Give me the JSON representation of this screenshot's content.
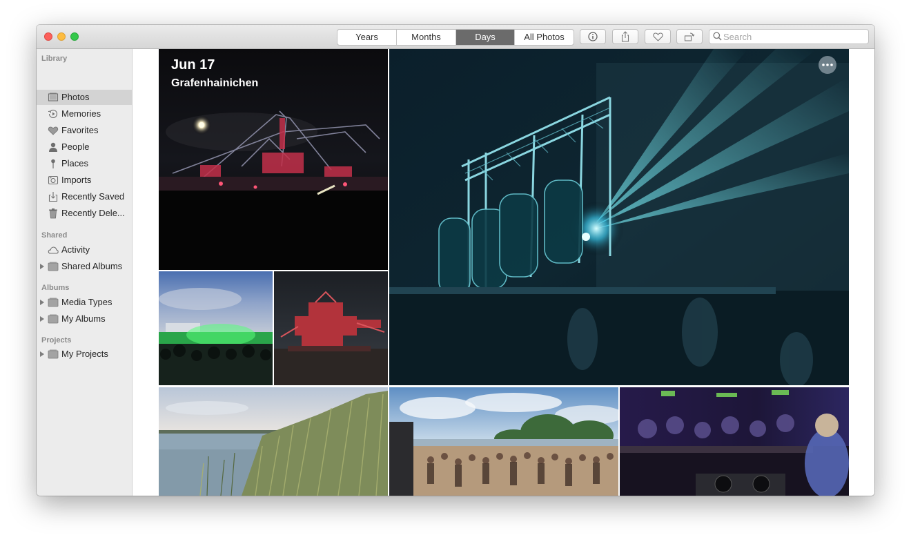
{
  "toolbar": {
    "segments": [
      {
        "label": "Years",
        "active": false
      },
      {
        "label": "Months",
        "active": false
      },
      {
        "label": "Days",
        "active": true
      },
      {
        "label": "All Photos",
        "active": false
      }
    ],
    "buttons": [
      "info-icon",
      "share-icon",
      "heart-icon",
      "rotate-icon"
    ],
    "search_placeholder": "Search"
  },
  "sidebar": {
    "library_title": "Library",
    "library_items": [
      {
        "label": "Photos",
        "icon": "photos-icon",
        "selected": true
      },
      {
        "label": "Memories",
        "icon": "memories-icon"
      },
      {
        "label": "Favorites",
        "icon": "heart-icon"
      },
      {
        "label": "People",
        "icon": "person-icon"
      },
      {
        "label": "Places",
        "icon": "pin-icon"
      },
      {
        "label": "Imports",
        "icon": "camera-icon"
      },
      {
        "label": "Recently Saved",
        "icon": "download-icon"
      },
      {
        "label": "Recently Dele...",
        "icon": "trash-icon"
      }
    ],
    "shared_title": "Shared",
    "shared_items": [
      {
        "label": "Activity",
        "icon": "cloud-icon"
      },
      {
        "label": "Shared Albums",
        "icon": "folder-icon",
        "disclosure": true
      }
    ],
    "albums_title": "Albums",
    "album_items": [
      {
        "label": "Media Types",
        "icon": "folder-icon",
        "disclosure": true
      },
      {
        "label": "My Albums",
        "icon": "folder-icon",
        "disclosure": true
      }
    ],
    "projects_title": "Projects",
    "project_items": [
      {
        "label": "My Projects",
        "icon": "folder-icon",
        "disclosure": true
      }
    ]
  },
  "day": {
    "date": "Jun 17",
    "location": "Grafenhainichen"
  },
  "colors": {
    "selected_row": "#d3d3d3",
    "active_segment": "#6b6b6b",
    "close": "#fc605b",
    "minimize": "#fdbc40",
    "maximize": "#34c84a"
  }
}
